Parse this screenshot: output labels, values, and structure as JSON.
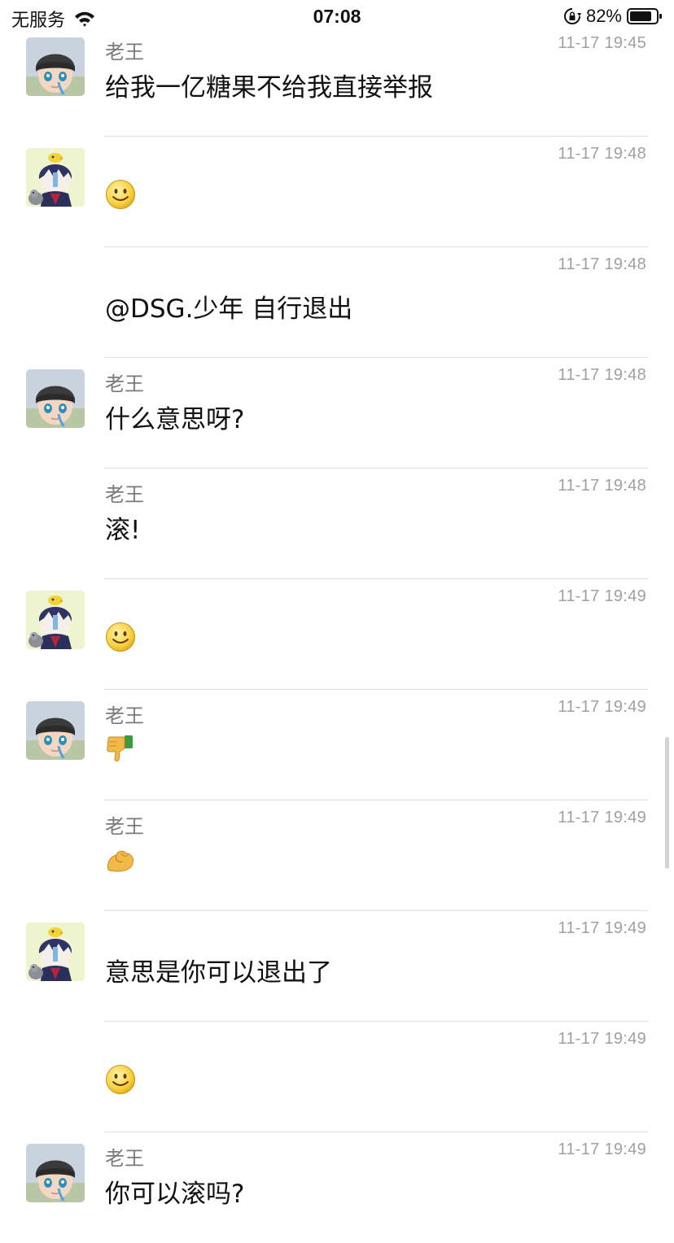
{
  "status_bar": {
    "carrier": "无服务",
    "time": "07:08",
    "battery": "82%"
  },
  "icons": {
    "avatar_laowang": "beanie-boy-avatar",
    "avatar_youth": "chick-hat-boy-avatar",
    "smile": "smiling-face-emoji",
    "thumbs_down": "thumbs-down-emoji",
    "flex": "flexed-arm-emoji"
  },
  "colors": {
    "divider": "#dedede",
    "timestamp": "#a0a0a0",
    "name": "#7a7a7a"
  },
  "messages": [
    {
      "author": "老王",
      "time": "11-17 19:45",
      "text": "给我一亿糖果不给我直接举报"
    },
    {
      "author": "",
      "time": "11-17 19:48",
      "emoji": "smiling-face-emoji"
    },
    {
      "author": "",
      "time": "11-17 19:48",
      "text": "@DSG.少年 自行退出"
    },
    {
      "author": "老王",
      "time": "11-17 19:48",
      "text": "什么意思呀?"
    },
    {
      "author": "老王",
      "time": "11-17 19:48",
      "text": "滚!"
    },
    {
      "author": "",
      "time": "11-17 19:49",
      "emoji": "smiling-face-emoji"
    },
    {
      "author": "老王",
      "time": "11-17 19:49",
      "emoji": "thumbs-down-emoji"
    },
    {
      "author": "老王",
      "time": "11-17 19:49",
      "emoji": "flexed-arm-emoji"
    },
    {
      "author": "",
      "time": "11-17 19:49",
      "text": "意思是你可以退出了"
    },
    {
      "author": "",
      "time": "11-17 19:49",
      "emoji": "smiling-face-emoji"
    },
    {
      "author": "老王",
      "time": "11-17 19:49",
      "text": "你可以滚吗?"
    }
  ]
}
